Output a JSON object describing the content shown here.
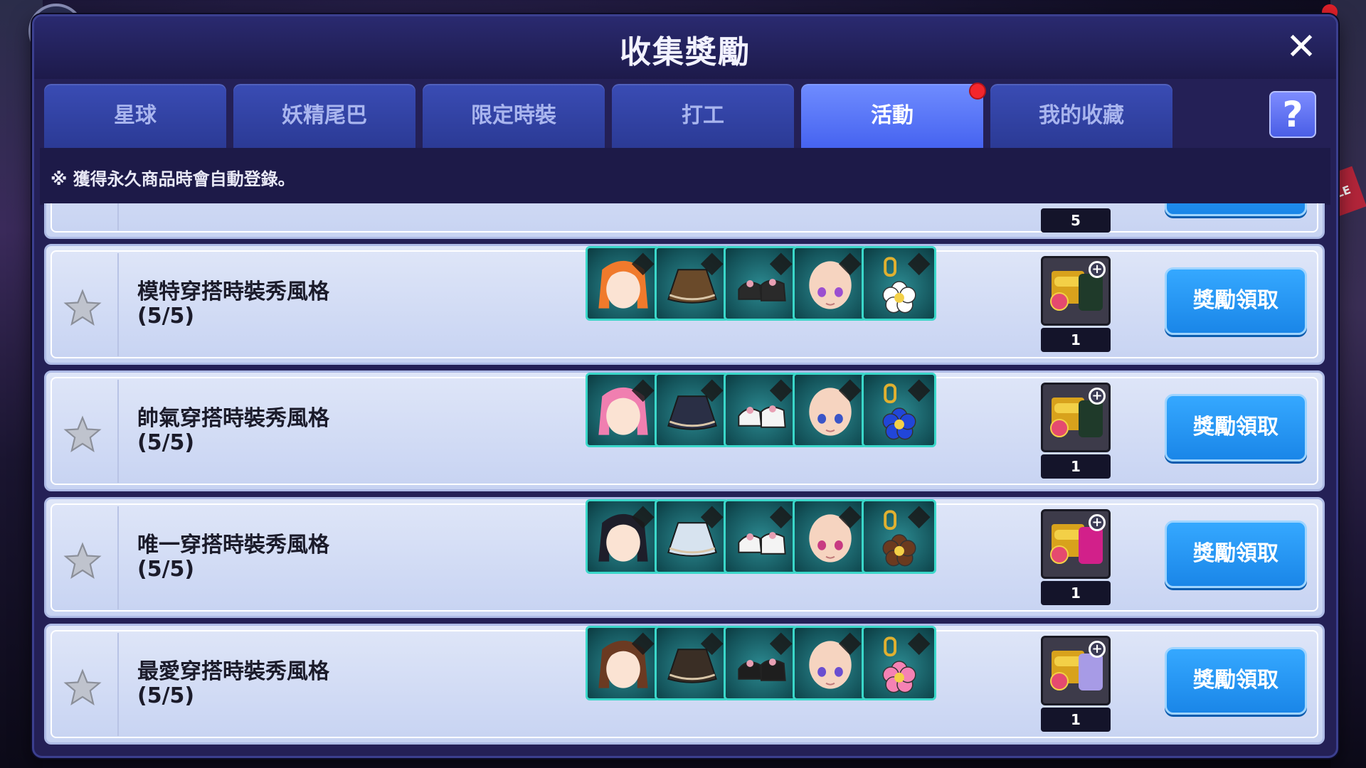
{
  "dialog": {
    "title": "收集獎勵",
    "close_label": "✕",
    "help_label": "?",
    "notice": "※ 獲得永久商品時會自動登錄。"
  },
  "tabs": [
    {
      "label": "星球",
      "active": false
    },
    {
      "label": "妖精尾巴",
      "active": false
    },
    {
      "label": "限定時裝",
      "active": false
    },
    {
      "label": "打工",
      "active": false
    },
    {
      "label": "活動",
      "active": true,
      "has_alert_dot": true
    },
    {
      "label": "我的收藏",
      "active": false
    }
  ],
  "partial_row": {
    "reward_count": "5"
  },
  "rows": [
    {
      "title_line1": "模特穿搭時裝秀風格",
      "title_line2": "(5/5)",
      "reward_count": "1",
      "claim_label": "獎勵領取",
      "hair_color": "#f07a2c",
      "skirt_color": "#6a4a2a",
      "shoes_color": "#2a2a2a",
      "eye_color": "#9b4fd0",
      "charm_color": "#ffffff",
      "outfit_color": "#1f3a2a"
    },
    {
      "title_line1": "帥氣穿搭時裝秀風格",
      "title_line2": "(5/5)",
      "reward_count": "1",
      "claim_label": "獎勵領取",
      "hair_color": "#f07fb0",
      "skirt_color": "#2a2f45",
      "shoes_color": "#f4f4f4",
      "eye_color": "#3a55c8",
      "charm_color": "#2146d8",
      "outfit_color": "#1f3a2a"
    },
    {
      "title_line1": "唯一穿搭時裝秀風格",
      "title_line2": "(5/5)",
      "reward_count": "1",
      "claim_label": "獎勵領取",
      "hair_color": "#1e1e2a",
      "skirt_color": "#d7e3ef",
      "shoes_color": "#f4f4f4",
      "eye_color": "#c83a82",
      "charm_color": "#6b3a1f",
      "outfit_color": "#d2208a"
    },
    {
      "title_line1": "最愛穿搭時裝秀風格",
      "title_line2": "(5/5)",
      "reward_count": "1",
      "claim_label": "獎勵領取",
      "hair_color": "#6b3a22",
      "skirt_color": "#3a2e25",
      "shoes_color": "#1e1e1e",
      "eye_color": "#6a4ed0",
      "charm_color": "#f582b4",
      "outfit_color": "#a79be6"
    }
  ],
  "icons": [
    "star-icon",
    "zoom-in-icon",
    "gift-box-icon",
    "close-icon",
    "help-icon"
  ]
}
